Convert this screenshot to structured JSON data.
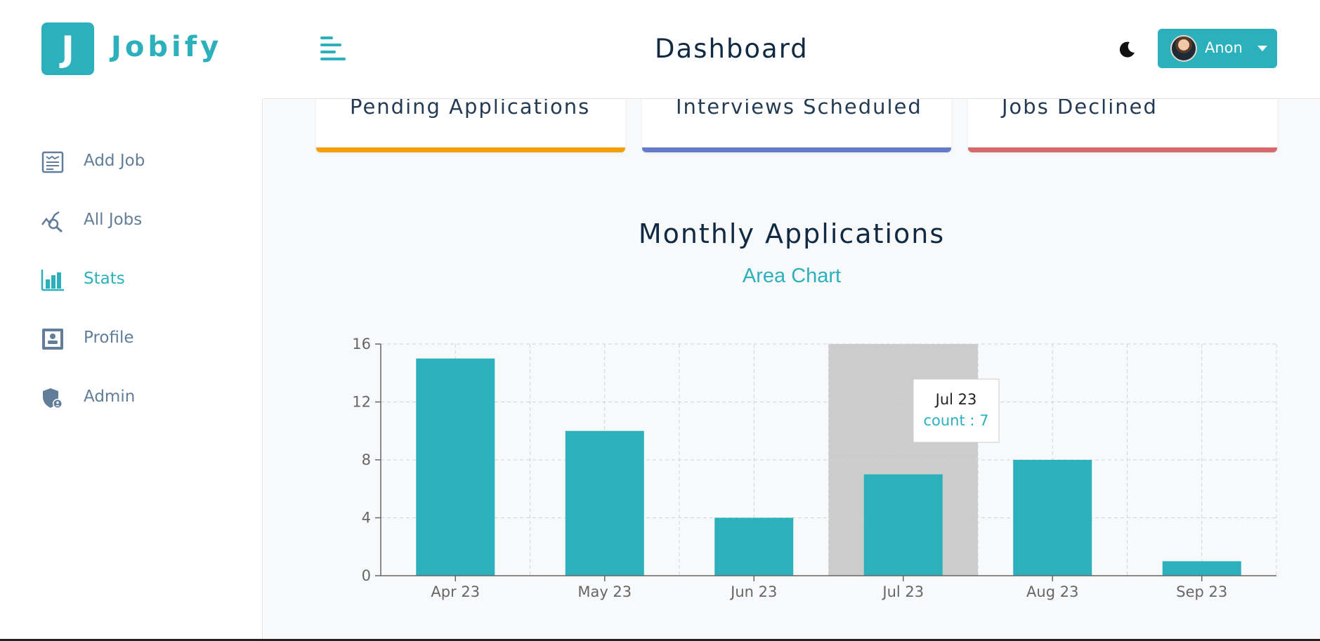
{
  "brand": {
    "logo_letter": "J",
    "name": "Jobify",
    "accent": "#2cb1bc"
  },
  "header": {
    "title": "Dashboard",
    "user_name": "Anon"
  },
  "sidebar": {
    "items": [
      {
        "label": "Add Job",
        "icon": "add-job-icon",
        "active": false
      },
      {
        "label": "All Jobs",
        "icon": "all-jobs-icon",
        "active": false
      },
      {
        "label": "Stats",
        "icon": "stats-icon",
        "active": true
      },
      {
        "label": "Profile",
        "icon": "profile-icon",
        "active": false
      },
      {
        "label": "Admin",
        "icon": "admin-icon",
        "active": false
      }
    ]
  },
  "stats": [
    {
      "title": "Pending Applications",
      "color": "#f59e0b"
    },
    {
      "title": "Interviews Scheduled",
      "color": "#647acb"
    },
    {
      "title": "Jobs Declined",
      "color": "#d66a6a"
    }
  ],
  "chart_section": {
    "title": "Monthly Applications",
    "toggle_label": "Area Chart"
  },
  "chart_data": {
    "type": "bar",
    "categories": [
      "Apr 23",
      "May 23",
      "Jun 23",
      "Jul 23",
      "Aug 23",
      "Sep 23"
    ],
    "series": [
      {
        "values": [
          15,
          10,
          4,
          7,
          8,
          1
        ]
      }
    ],
    "ylim": [
      0,
      16
    ],
    "yticks": [
      0,
      4,
      8,
      12,
      16
    ],
    "grid": true,
    "bar_color": "#2cb1bc",
    "highlight_color": "#cccccc",
    "tooltip": {
      "label": "Jul 23",
      "text": "count : 7"
    }
  }
}
